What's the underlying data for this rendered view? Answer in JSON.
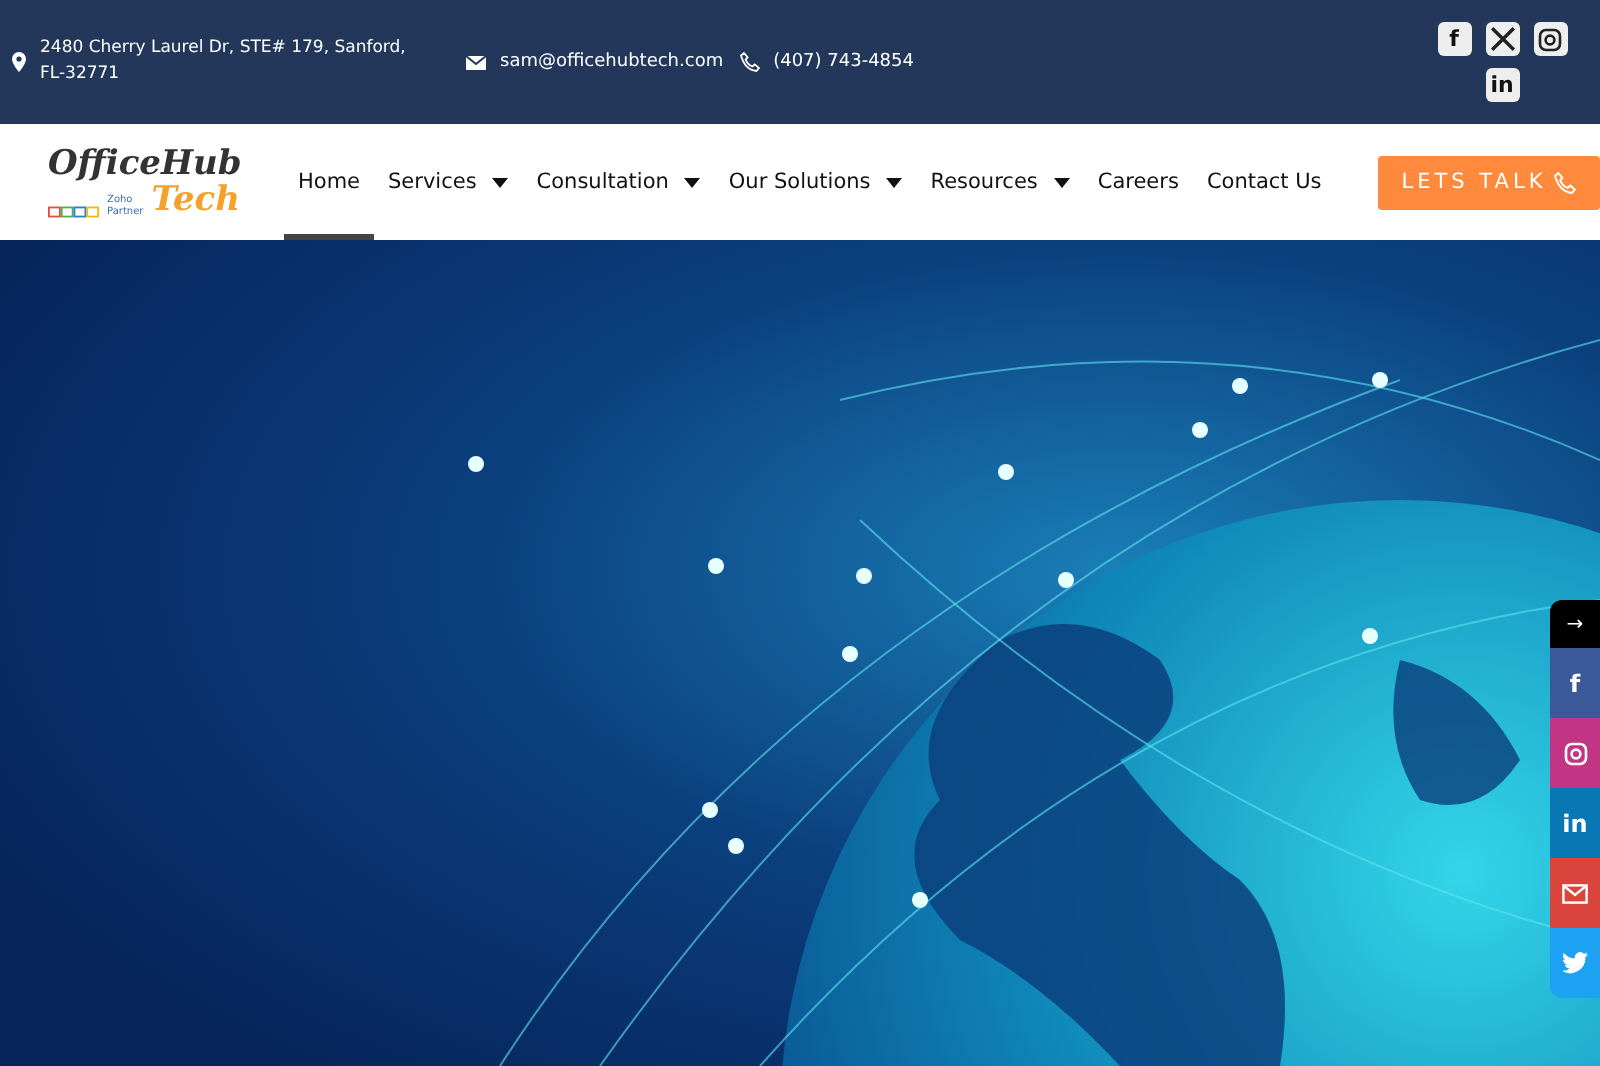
{
  "top_bar": {
    "address": "2480 Cherry Laurel Dr, STE# 179, Sanford, FL-32771",
    "email": "sam@officehubtech.com",
    "phone": "(407) 743-4854",
    "social": [
      {
        "kind": "facebook",
        "glyph": "f"
      },
      {
        "kind": "x"
      },
      {
        "kind": "instagram"
      },
      {
        "kind": "linkedin",
        "glyph": "in"
      }
    ]
  },
  "logo": {
    "line1": "OfficeHub",
    "line2": "Tech",
    "badge": "Zoho Partner"
  },
  "nav": [
    {
      "label": "Home",
      "selected": true,
      "has_menu": false
    },
    {
      "label": "Services",
      "selected": false,
      "has_menu": true
    },
    {
      "label": "Consultation",
      "selected": false,
      "has_menu": true
    },
    {
      "label": "Our Solutions",
      "selected": false,
      "has_menu": true
    },
    {
      "label": "Resources",
      "selected": false,
      "has_menu": true
    },
    {
      "label": "Careers",
      "selected": false,
      "has_menu": false
    },
    {
      "label": "Contact Us",
      "selected": false,
      "has_menu": false
    }
  ],
  "cta": {
    "label": "LETS TALK"
  },
  "share_bar": [
    {
      "kind": "toggle",
      "glyph": "→",
      "color": "#000000"
    },
    {
      "kind": "facebook",
      "glyph": "f",
      "color": "#3b5998"
    },
    {
      "kind": "instagram",
      "color": "#c13584"
    },
    {
      "kind": "linkedin",
      "glyph": "in",
      "color": "#0a77b5"
    },
    {
      "kind": "email",
      "color": "#d9453c"
    },
    {
      "kind": "twitter",
      "color": "#1da1f2"
    }
  ]
}
